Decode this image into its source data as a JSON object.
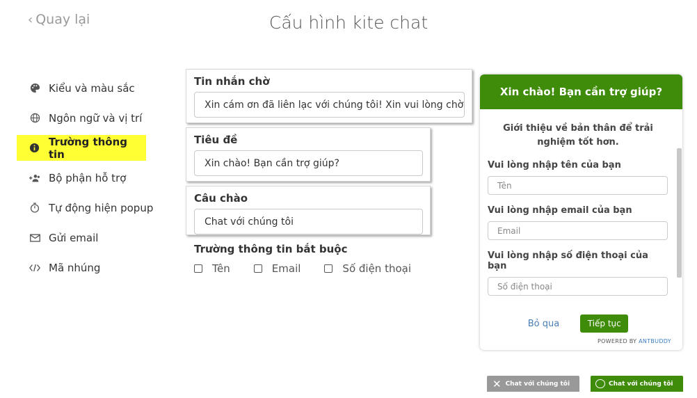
{
  "nav": {
    "back_label": "Quay lại"
  },
  "header": {
    "title": "Cấu hình kite chat"
  },
  "sidebar": {
    "items": [
      {
        "label": "Kiểu và màu sắc",
        "icon": "palette-icon"
      },
      {
        "label": "Ngôn ngữ và vị trí",
        "icon": "globe-icon"
      },
      {
        "label": "Trường thông tin",
        "icon": "info-icon",
        "active": true
      },
      {
        "label": "Bộ phận hỗ trợ",
        "icon": "people-icon"
      },
      {
        "label": "Tự động hiện popup",
        "icon": "timer-icon"
      },
      {
        "label": "Gửi email",
        "icon": "mail-icon"
      },
      {
        "label": "Mã nhúng",
        "icon": "code-icon"
      }
    ]
  },
  "form": {
    "waiting": {
      "label": "Tin nhắn chờ",
      "value": "Xin cám ơn đã liên lạc với chúng tôi! Xin vui lòng chờ tro"
    },
    "title": {
      "label": "Tiêu đề",
      "value": "Xin chào! Bạn cần trợ giúp?"
    },
    "greeting": {
      "label": "Câu chào",
      "value": "Chat với chúng tôi"
    },
    "required": {
      "label": "Trường thông tin bắt buộc",
      "options": [
        "Tên",
        "Email",
        "Số điện thoại"
      ]
    }
  },
  "preview": {
    "header": "Xin chào! Bạn cần trợ giúp?",
    "intro": "Giới thiệu về bản thân để trải nghiệm tốt hơn.",
    "name_label": "Vui lòng nhập tên của bạn",
    "name_placeholder": "Tên",
    "email_label": "Vui lòng nhập email của bạn",
    "email_placeholder": "Email",
    "phone_label": "Vui lòng nhập số điện thoại của bạn",
    "phone_placeholder": "Số điện thoại",
    "cancel": "Bỏ qua",
    "next": "Tiếp tục",
    "powered_by": "POWERED BY",
    "brand": "ANTBUDDY"
  },
  "tabs": {
    "closed_label": "Chat với chúng tôi",
    "open_label": "Chat với chúng tôi"
  },
  "colors": {
    "accent": "#3f8c0a",
    "highlight": "#ffff33",
    "link": "#4a7db5"
  }
}
